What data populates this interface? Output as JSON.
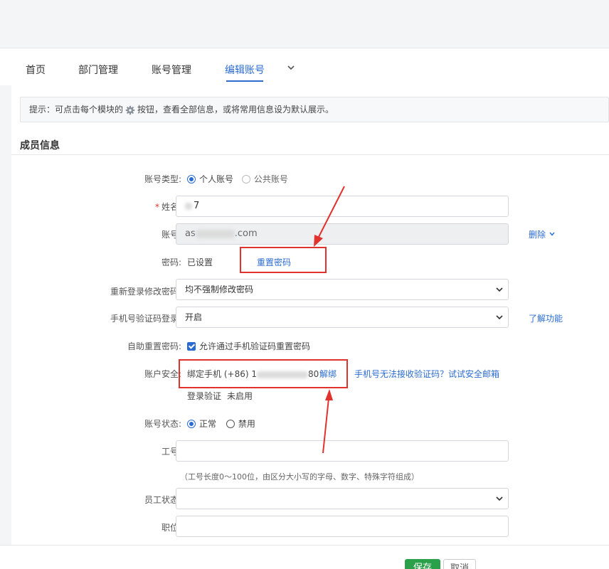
{
  "nav": {
    "tabs": [
      {
        "label": "首页"
      },
      {
        "label": "部门管理"
      },
      {
        "label": "账号管理"
      },
      {
        "label": "编辑账号"
      }
    ]
  },
  "tip": {
    "before": "提示：可点击每个模块的",
    "after": "按钮，查看全部信息，或将常用信息设为默认展示。"
  },
  "section_title": "成员信息",
  "form": {
    "account_type": {
      "label": "账号类型:",
      "options": [
        "个人账号",
        "公共账号"
      ],
      "selected": "个人账号"
    },
    "name": {
      "label": "姓名:",
      "value_suffix": "7"
    },
    "account": {
      "label": "账号:",
      "value_prefix": "as",
      "value_suffix": ".com",
      "action": "删除"
    },
    "password": {
      "label": "密码:",
      "status": "已设置",
      "action": "重置密码"
    },
    "relogin": {
      "label": "重新登录修改密码:",
      "value": "均不强制修改密码"
    },
    "sms_login": {
      "label": "手机号验证码登录:",
      "value": "开启",
      "help": "了解功能"
    },
    "self_reset": {
      "label": "自助重置密码:",
      "checkbox_label": "允许通过手机验证码重置密码",
      "checked": true
    },
    "security": {
      "label": "账户安全:",
      "phone_label": "绑定手机",
      "phone_prefix": "(+86) 1",
      "phone_suffix": "80",
      "unbind": "解绑",
      "email_link": "手机号无法接收验证码？试试安全邮箱",
      "login_verify": "登录验证",
      "login_verify_status": "未启用"
    },
    "status": {
      "label": "账号状态:",
      "options": [
        "正常",
        "禁用"
      ],
      "selected": "正常"
    },
    "employee_id": {
      "label": "工号:",
      "hint": "（工号长度0～100位，由区分大小写的字母、数字、特殊字符组成）"
    },
    "employee_status": {
      "label": "员工状态:"
    },
    "position": {
      "label": "职位:"
    }
  },
  "buttons": {
    "save": "保存",
    "cancel": "取消"
  },
  "colors": {
    "accent": "#2b6cd2",
    "save_green": "#2aa04a",
    "annotation_red": "#e0332d"
  }
}
